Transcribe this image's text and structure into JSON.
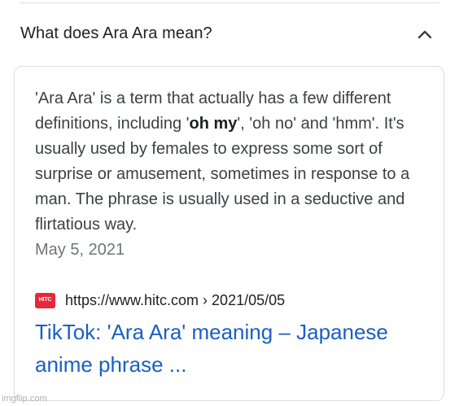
{
  "question": "What does Ara Ara mean?",
  "icons": {
    "expand": "chevron-up-icon",
    "favicon": "hitc-favicon"
  },
  "answer": {
    "part1": "'Ara Ara' is a term that actually has a few different definitions, including '",
    "bold": "oh my",
    "part2": "', 'oh no' and 'hmm'. It's usually used by females to express some sort of surprise or amusement, sometimes in response to a man. The phrase is usually used in a seductive and flirtatious way.",
    "date": "May 5, 2021"
  },
  "source": {
    "favicon_text": "HITC",
    "url": "https://www.hitc.com › 2021/05/05"
  },
  "result": {
    "title": "TikTok: 'Ara Ara' meaning – Japanese anime phrase ..."
  },
  "watermark": "imgflip.com",
  "colors": {
    "link": "#1a5fc4",
    "favicon_bg": "#e8273c",
    "divider": "#dadce0"
  }
}
